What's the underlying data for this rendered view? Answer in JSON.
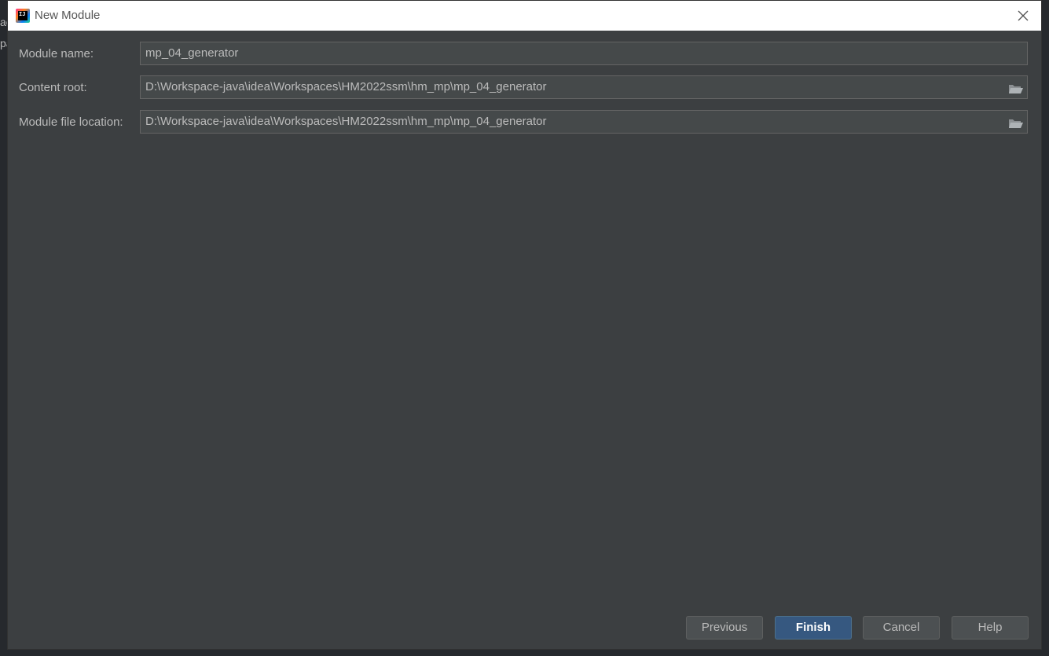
{
  "window": {
    "title": "New Module",
    "app_icon_text": "IJ"
  },
  "form": {
    "module_name": {
      "label": "Module name:",
      "value": "mp_04_generator"
    },
    "content_root": {
      "label": "Content root:",
      "value": "D:\\Workspace-java\\idea\\Workspaces\\HM2022ssm\\hm_mp\\mp_04_generator"
    },
    "module_file_location": {
      "label": "Module file location:",
      "value": "D:\\Workspace-java\\idea\\Workspaces\\HM2022ssm\\hm_mp\\mp_04_generator"
    }
  },
  "buttons": {
    "previous": "Previous",
    "finish": "Finish",
    "cancel": "Cancel",
    "help": "Help"
  },
  "backdrop": {
    "text_1": "ac",
    "text_2": "pa"
  },
  "colors": {
    "dialog_bg": "#3c3f41",
    "field_bg": "#45494a",
    "primary_button": "#365880",
    "text": "#bbbbbb"
  },
  "icons": {
    "app": "intellij-idea-icon",
    "close": "close-icon",
    "browse": "folder-open-icon"
  }
}
